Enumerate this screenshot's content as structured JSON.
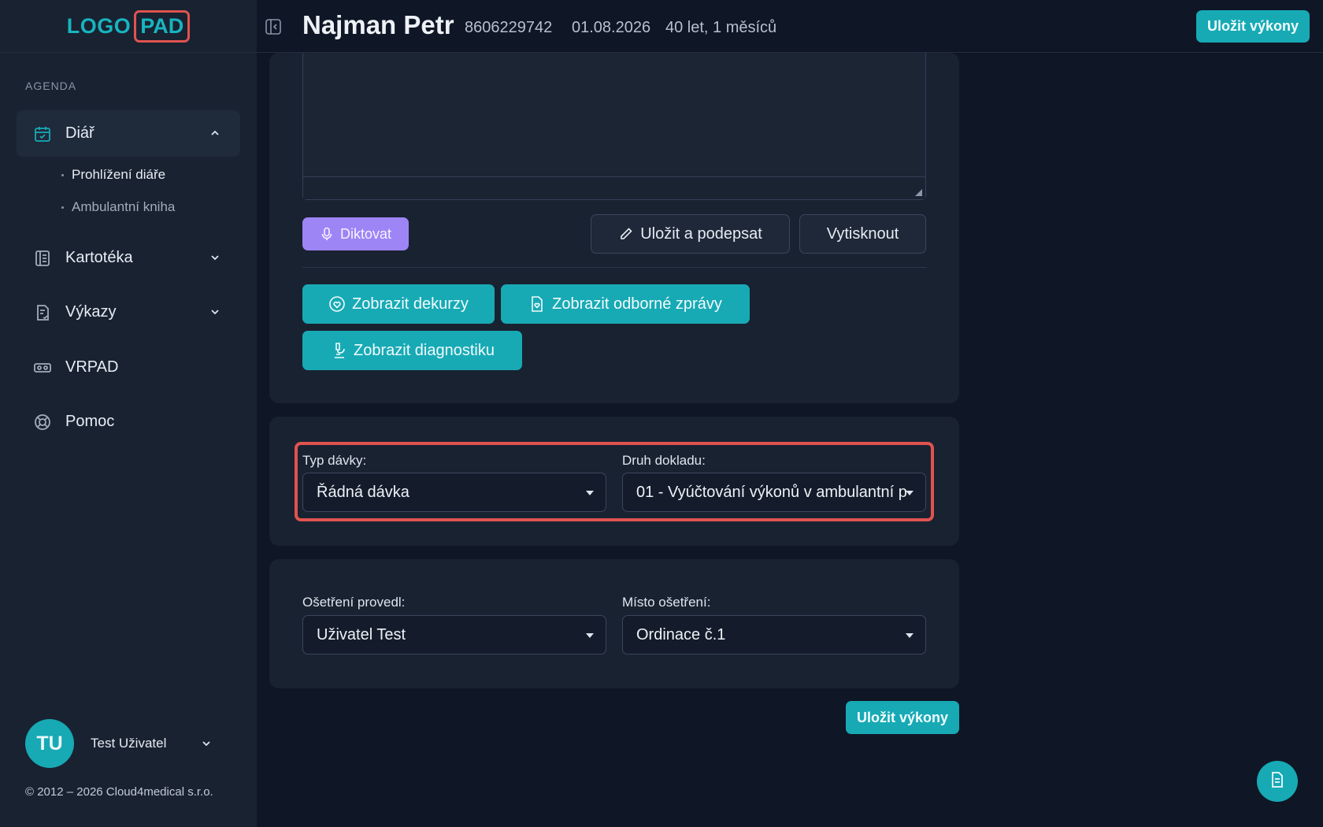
{
  "logo": {
    "part1": "LOGO",
    "part2": "PAD"
  },
  "sidebar": {
    "section_label": "AGENDA",
    "items": [
      {
        "label": "Diář",
        "icon": "calendar-check-icon",
        "expanded": true
      },
      {
        "label": "Kartotéka",
        "icon": "address-book-icon"
      },
      {
        "label": "Výkazy",
        "icon": "report-icon"
      },
      {
        "label": "VRPAD",
        "icon": "vr-headset-icon"
      },
      {
        "label": "Pomoc",
        "icon": "lifebuoy-icon"
      }
    ],
    "subitems": [
      {
        "label": "Prohlížení diáře",
        "current": true
      },
      {
        "label": "Ambulantní kniha",
        "current": false
      }
    ],
    "user": {
      "initials": "TU",
      "name": "Test Uživatel"
    },
    "copyright": "© 2012 – 2026 Cloud4medical s.r.o."
  },
  "header": {
    "patient_name": "Najman Petr",
    "patient_id": "8606229742",
    "date": "01.08.2026",
    "age": "40 let, 1 měsíců",
    "save_label": "Uložit výkony"
  },
  "editor": {
    "dictate_label": "Diktovat",
    "save_sign_label": "Uložit a podepsat",
    "print_label": "Vytisknout"
  },
  "actions": {
    "decursus_label": "Zobrazit dekurzy",
    "reports_label": "Zobrazit odborné zprávy",
    "diagnostics_label": "Zobrazit diagnostiku"
  },
  "batch": {
    "type_label": "Typ dávky:",
    "type_value": "Řádná dávka",
    "doc_label": "Druh dokladu:",
    "doc_value": "01 - Vyúčtování výkonů v ambulantní p"
  },
  "treatment": {
    "by_label": "Ošetření provedl:",
    "by_value": "Uživatel Test",
    "place_label": "Místo ošetření:",
    "place_value": "Ordinace č.1"
  },
  "footer": {
    "save_label": "Uložit výkony"
  },
  "colors": {
    "accent": "#17aab5",
    "purple": "#9d85f6",
    "highlight": "#e0534f",
    "background": "#0f1626",
    "panel": "#192231"
  }
}
